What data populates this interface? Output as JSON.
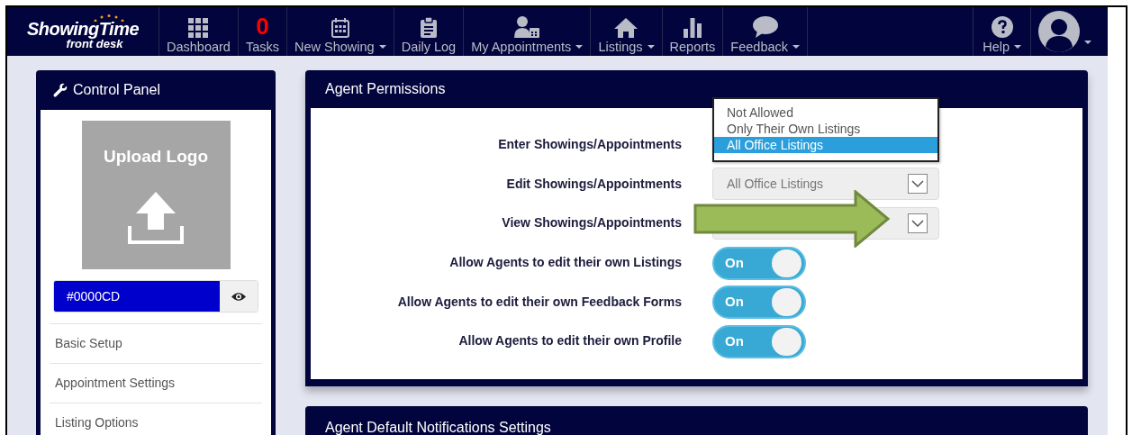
{
  "nav": {
    "logo": {
      "title": "ShowingTime",
      "subtitle": "front desk"
    },
    "items": [
      {
        "kind": "link",
        "label": "Dashboard",
        "dropdown": false
      },
      {
        "kind": "count",
        "count": "0",
        "label": "Tasks",
        "dropdown": false
      },
      {
        "kind": "link",
        "label": "New Showing",
        "dropdown": true
      },
      {
        "kind": "link",
        "label": "Daily Log",
        "dropdown": false
      },
      {
        "kind": "link",
        "label": "My Appointments",
        "dropdown": true
      },
      {
        "kind": "link",
        "label": "Listings",
        "dropdown": true
      },
      {
        "kind": "link",
        "label": "Reports",
        "dropdown": false
      },
      {
        "kind": "link",
        "label": "Feedback",
        "dropdown": true
      }
    ],
    "right": [
      {
        "kind": "link",
        "label": "Help",
        "dropdown": true
      },
      {
        "kind": "avatar",
        "dropdown": true
      }
    ]
  },
  "sidebar": {
    "title": "Control Panel",
    "upload_logo": "Upload Logo",
    "color_field": {
      "value": "#0000CD",
      "color": "#0000cd"
    },
    "menu": [
      "Basic Setup",
      "Appointment Settings",
      "Listing Options"
    ]
  },
  "permissions": {
    "title": "Agent Permissions",
    "rows": [
      {
        "kind": "select",
        "label": "Enter Showings/Appointments",
        "open": true,
        "options": [
          {
            "label": "Not Allowed",
            "selected": false
          },
          {
            "label": "Only Their Own Listings",
            "selected": false
          },
          {
            "label": "All Office Listings",
            "selected": true
          }
        ]
      },
      {
        "kind": "select",
        "label": "Edit Showings/Appointments",
        "open": false,
        "value": "All Office Listings"
      },
      {
        "kind": "select",
        "label": "View Showings/Appointments",
        "open": false
      },
      {
        "kind": "toggle",
        "label": "Allow Agents to edit their own Listings",
        "on": true,
        "state_label": "On"
      },
      {
        "kind": "toggle",
        "label": "Allow Agents to edit their own Feedback Forms",
        "on": true,
        "state_label": "On"
      },
      {
        "kind": "toggle",
        "label": "Allow Agents to edit their own Profile",
        "on": true,
        "state_label": "On"
      }
    ]
  },
  "notifications": {
    "title": "Agent Default Notifications Settings"
  }
}
